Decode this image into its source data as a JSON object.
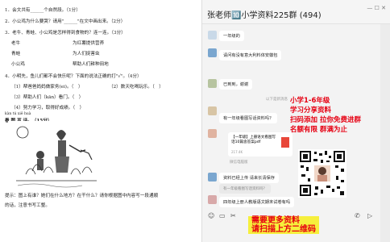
{
  "document": {
    "lines": [
      "1．会文共有______个自然段。（1分）",
      "2．小公鸡为什么要哭？请用\"______\"在文中画出来。（2分）",
      "3．老牛、青蛙、小公鸡是怎样得到食物的？连一连。（3分）",
      "4．小明先，鱼儿们都不会快乐呢？下面的说法正确的打\"√\"。（4分）",
      "kàn tú xiě huà",
      "看 图 写 话。（15分）",
      "提示：图上有谁？她们在什么地方？在干什么？请你根据图中内容写一段通顺",
      "的话，注意书写工整。"
    ],
    "match_left": [
      "老牛",
      "青蛙",
      "小公鸡"
    ],
    "match_right": [
      "为红薯提供营养",
      "为人们捉害虫",
      "帮助人们耕种田地"
    ],
    "options": [
      "（1）帮爸爸妈妈做家务(ei)。（　）",
      "（2）数天吃喝玩乐。（　）",
      "（3）帮助人们（kān）看门。（　）",
      "（4）努力学习，取得好成绩。（　）"
    ]
  },
  "chat": {
    "title": "张老师🔟小学资料225群 (494)",
    "window_buttons": "— ☐ ✕",
    "messages": [
      {
        "text": "一年级的"
      },
      {
        "text": "请问有没有意大利料体安徽包"
      },
      {
        "text": "已到到，谢谢"
      },
      {
        "text": "有一年级看图写话资料吗？"
      },
      {
        "text": "【一年级】上册语文看图写话10篇含答案pdf"
      },
      {
        "text": "217.4K"
      },
      {
        "text": "微信电脑版"
      },
      {
        "text": "资料已经上传 请来长清保存"
      },
      {
        "text": "有一年级看图写话资料吗？"
      },
      {
        "text": "四年级上册人教版语文期末试卷有吗"
      }
    ],
    "sys_notes": [
      "以下是新消息"
    ],
    "promo_lines": [
      "小学1-6年级",
      "学习分享资料",
      "扫码添加 拉你免费进群",
      "名额有限 群满为止"
    ],
    "banner_lines": [
      "需要更多资料",
      "请扫描上方二维码"
    ]
  },
  "colors": {
    "accent_red": "#e60012",
    "bubble_green": "#9eea6a",
    "banner_yellow": "#f6ef3c"
  }
}
